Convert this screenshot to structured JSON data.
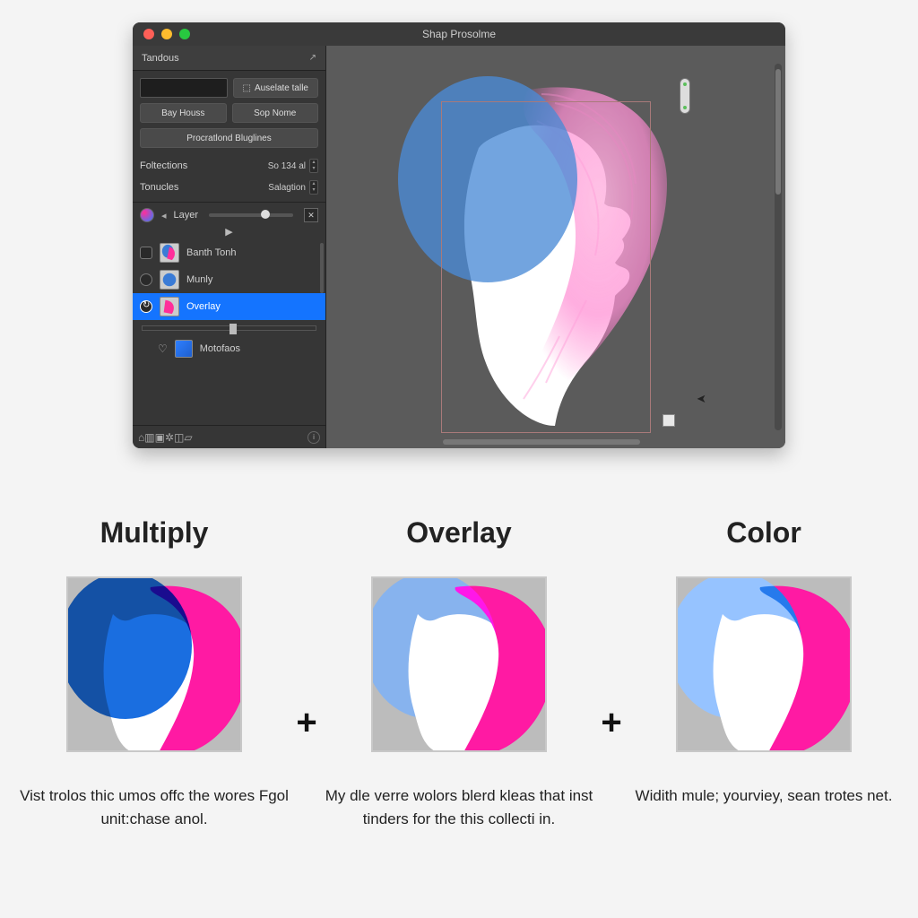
{
  "window": {
    "title": "Shap Prosolme"
  },
  "panel": {
    "tab": "Tandous",
    "toggle_label": "Auselate talle",
    "btn1": "Bay Houss",
    "btn2": "Sop Nome",
    "btn3": "Procratlond Bluglines",
    "prop1_label": "Foltections",
    "prop1_value": "So 134 al",
    "prop2_label": "Tonucles",
    "prop2_value": "Salagtion",
    "layer_label": "Layer",
    "layers": [
      {
        "name": "Banth Tonh"
      },
      {
        "name": "Munly"
      },
      {
        "name": "Overlay"
      }
    ],
    "subitem": "Motofaos"
  },
  "compare": {
    "titles": [
      "Multiply",
      "Overlay",
      "Color"
    ],
    "descs": [
      "Vist trolos thic umos offc the wores Fgol unit:chase anol.",
      "My dle verre wolors blerd kleas that inst tinders for the this collecti in.",
      "Widith mule; yourviey, sean trotes net."
    ],
    "plus": "+"
  }
}
